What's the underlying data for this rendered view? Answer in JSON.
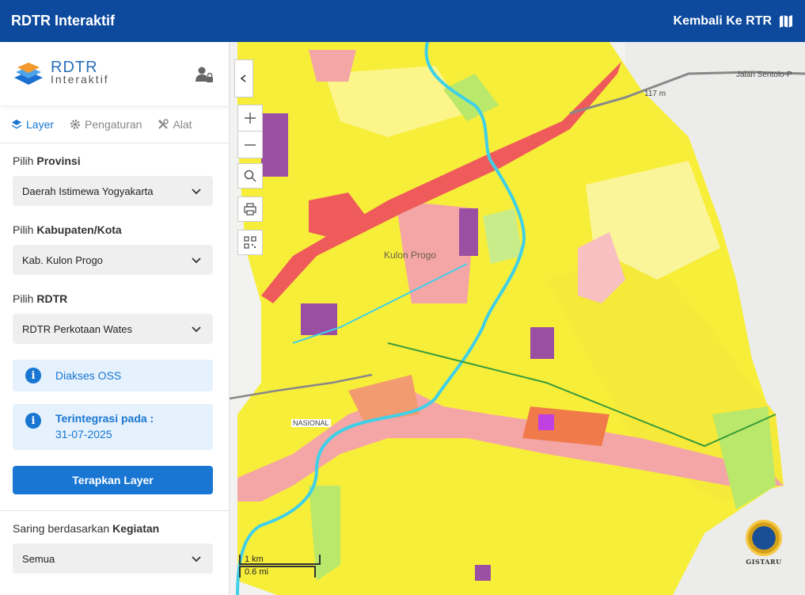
{
  "header": {
    "title": "RDTR Interaktif",
    "back_label": "Kembali Ke RTR"
  },
  "sidebar": {
    "logo": {
      "line1": "RDTR",
      "line2": "Interaktif"
    },
    "tabs": [
      {
        "label": "Layer",
        "icon": "layers-icon",
        "active": true
      },
      {
        "label": "Pengaturan",
        "icon": "gear-icon",
        "active": false
      },
      {
        "label": "Alat",
        "icon": "tools-icon",
        "active": false
      }
    ],
    "province": {
      "label_prefix": "Pilih ",
      "label_bold": "Provinsi",
      "value": "Daerah Istimewa Yogyakarta"
    },
    "regency": {
      "label_prefix": "Pilih ",
      "label_bold": "Kabupaten/Kota",
      "value": "Kab. Kulon Progo"
    },
    "rdtr": {
      "label_prefix": "Pilih ",
      "label_bold": "RDTR",
      "value": "RDTR Perkotaan Wates"
    },
    "info_oss": "Diakses OSS",
    "info_integrated": {
      "title": "Terintegrasi pada :",
      "date": "31-07-2025"
    },
    "apply_label": "Terapkan Layer",
    "filter": {
      "label_prefix": "Saring berdasarkan ",
      "label_bold": "Kegiatan",
      "value": "Semua"
    }
  },
  "map": {
    "labels": {
      "kulon_progo": "Kulon Progo",
      "road": "Jalan Sentolo-P",
      "elevation": "117 m",
      "nasional": "NASIONAL"
    },
    "scale": {
      "km": "1 km",
      "mi": "0.6 mi"
    },
    "emblem_label": "GISTARU",
    "colors": {
      "residential": "#f7ee3a",
      "commercial": "#f4a6a6",
      "road_zone": "#ef5a5a",
      "green": "#b9e86a",
      "industrial": "#9b4fa3",
      "river": "#3fd0e8"
    }
  }
}
